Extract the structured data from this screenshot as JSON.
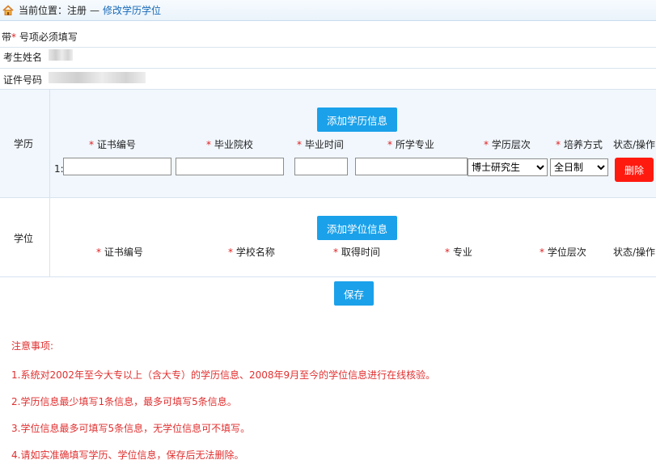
{
  "breadcrumb": {
    "prefix": "当前位置：注册",
    "separator": "—",
    "current": "修改学历学位"
  },
  "required_note": {
    "before": "带",
    "star": "*",
    "after": "号项必须填写"
  },
  "info": {
    "name_label": "考生姓名",
    "id_label": "证件号码"
  },
  "education": {
    "section_title": "学历",
    "add_button": "添加学历信息",
    "headers": [
      "证书编号",
      "毕业院校",
      "毕业时间",
      "所学专业",
      "学历层次",
      "培养方式"
    ],
    "status_header": "状态/操作",
    "row_index": "1:",
    "row": {
      "cert_no": "",
      "school": "",
      "grad_time": "",
      "major": "",
      "level": "博士研究生",
      "mode": "全日制"
    },
    "level_options": [
      "博士研究生"
    ],
    "mode_options": [
      "全日制"
    ],
    "delete_button": "删除"
  },
  "degree": {
    "section_title": "学位",
    "add_button": "添加学位信息",
    "headers": [
      "证书编号",
      "学校名称",
      "取得时间",
      "专业",
      "学位层次"
    ],
    "status_header": "状态/操作"
  },
  "save_button": "保存",
  "notes": {
    "title": "注意事项:",
    "items": [
      "1.系统对2002年至今大专以上（含大专）的学历信息、2008年9月至今的学位信息进行在线核验。",
      "2.学历信息最少填写1条信息，最多可填写5条信息。",
      "3.学位信息最多可填写5条信息，无学位信息可不填写。",
      "4.请如实准确填写学历、学位信息，保存后无法删除。"
    ]
  },
  "colors": {
    "accent": "#1aa1ea",
    "danger": "#ff1a10",
    "note": "#e03030",
    "link": "#1769b8"
  }
}
